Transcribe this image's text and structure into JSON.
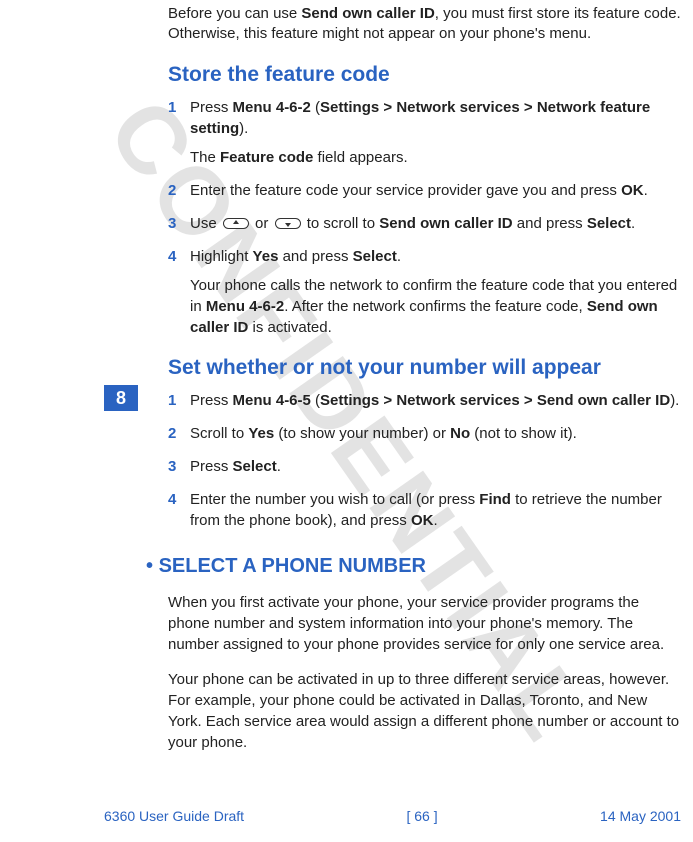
{
  "watermark": "CONFIDENTIAL",
  "chapter_tab": "8",
  "intro_html": "Before you can use <b>Send own caller ID</b>, you must first store its feature code. Otherwise, this feature might not appear on your phone's menu.",
  "sections": {
    "store": {
      "title": "Store the feature code",
      "steps": [
        {
          "num": "1",
          "html": "Press <b>Menu 4-6-2</b> (<b>Settings &gt; Network services &gt; Network feature setting</b>).",
          "sub_html": "The <b>Feature code</b> field appears."
        },
        {
          "num": "2",
          "html": "Enter the feature code your service provider gave you and press <b>OK</b>."
        },
        {
          "num": "3",
          "html": "Use <span class=\"key-icon up\" data-name=\"scroll-up-key-icon\" data-interactable=\"false\"></span> or <span class=\"key-icon down\" data-name=\"scroll-down-key-icon\" data-interactable=\"false\"></span> to scroll to <b>Send own caller ID</b> and press <b>Select</b>."
        },
        {
          "num": "4",
          "html": "Highlight <b>Yes</b> and press <b>Select</b>.",
          "sub_html": "Your phone calls the network to confirm the feature code that you entered in <b>Menu 4-6-2</b>. After the network confirms the feature code, <b>Send own caller ID</b> is activated."
        }
      ]
    },
    "set": {
      "title": "Set whether or not your number will appear",
      "steps": [
        {
          "num": "1",
          "html": "Press <b>Menu 4-6-5</b> (<b>Settings &gt; Network services &gt; Send own caller ID</b>)."
        },
        {
          "num": "2",
          "html": "Scroll to <b>Yes</b> (to show your number) or <b>No</b> (not to show it)."
        },
        {
          "num": "3",
          "html": "Press <b>Select</b>."
        },
        {
          "num": "4",
          "html": "Enter the number you wish to call (or press <b>Find</b> to retrieve the number from the phone book), and press <b>OK</b>."
        }
      ]
    },
    "select": {
      "title": "SELECT A PHONE NUMBER",
      "paras": [
        "When you first activate your phone, your service provider programs the phone number and system information into your phone's memory. The number assigned to your phone provides service for only one service area.",
        "Your phone can be activated in up to three different service areas, however. For example, your phone could be activated in Dallas, Toronto, and New York. Each service area would assign a different phone number or account to your phone."
      ]
    }
  },
  "footer": {
    "left": "6360 User Guide Draft",
    "center": "[ 66 ]",
    "right": "14 May 2001"
  }
}
